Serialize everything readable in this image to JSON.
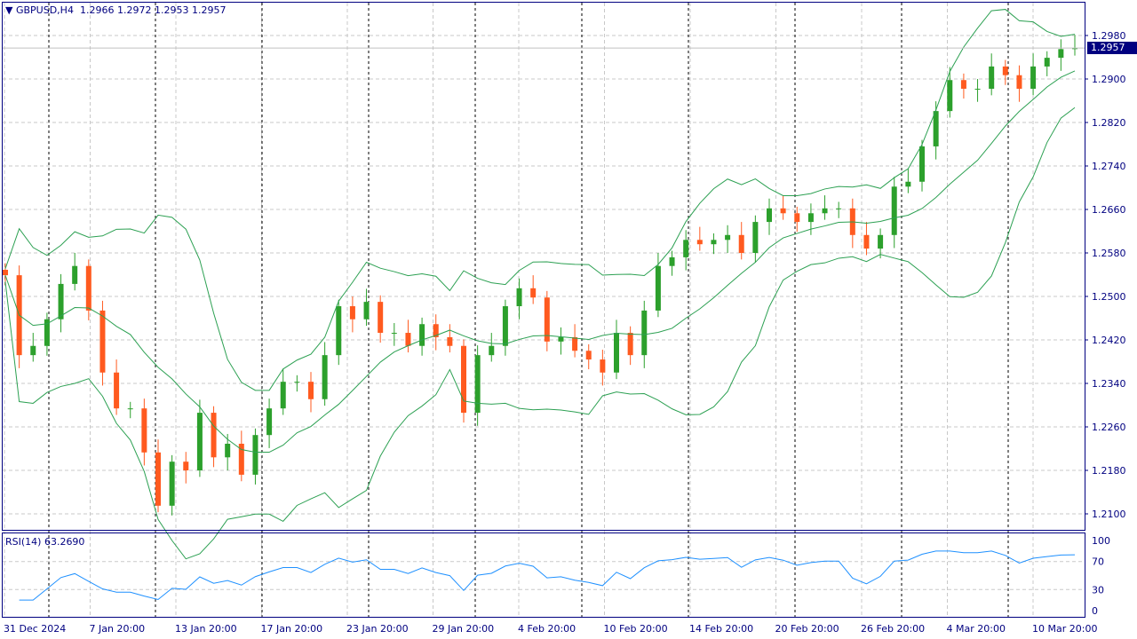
{
  "header": {
    "symbol": "GBPUSD,H4",
    "open": "1.2966",
    "high": "1.2972",
    "low": "1.2953",
    "close": "1.2957"
  },
  "current_price_label": "1.2957",
  "rsi_label": "RSI(14) 63.2690",
  "colors": {
    "frame": "#000080",
    "bull": "#2ca02c",
    "bear": "#ff5a1f",
    "bands": "#2ca052",
    "rsi": "#1e90ff",
    "grid": "#c8c8c8"
  },
  "chart_data": {
    "type": "candlestick",
    "title": "GBPUSD,H4",
    "ylim": [
      1.208,
      1.304
    ],
    "yticks": [
      "1.2980",
      "1.2900",
      "1.2820",
      "1.2740",
      "1.2660",
      "1.2580",
      "1.2500",
      "1.2420",
      "1.2340",
      "1.2260",
      "1.2180",
      "1.2100"
    ],
    "xticks": [
      "31 Dec 2024",
      "7 Jan 20:00",
      "13 Jan 20:00",
      "17 Jan 20:00",
      "23 Jan 20:00",
      "29 Jan 20:00",
      "4 Feb 20:00",
      "10 Feb 20:00",
      "14 Feb 20:00",
      "20 Feb 20:00",
      "26 Feb 20:00",
      "4 Mar 20:00",
      "10 Mar 20:00"
    ],
    "closes": [
      1.2539,
      1.2392,
      1.2409,
      1.2458,
      1.2523,
      1.2556,
      1.2474,
      1.236,
      1.2294,
      1.2294,
      1.2213,
      1.2115,
      1.2196,
      1.218,
      1.2286,
      1.2204,
      1.2229,
      1.2172,
      1.2245,
      1.2294,
      1.2343,
      1.2343,
      1.2311,
      1.2392,
      1.2482,
      1.2458,
      1.249,
      1.2433,
      1.2433,
      1.2409,
      1.2449,
      1.2425,
      1.2409,
      1.2286,
      1.2392,
      1.2409,
      1.2482,
      1.2515,
      1.2498,
      1.2417,
      1.2425,
      1.24,
      1.2384,
      1.236,
      1.2433,
      1.2392,
      1.2474,
      1.2556,
      1.2572,
      1.2604,
      1.2596,
      1.2604,
      1.2613,
      1.258,
      1.2637,
      1.2662,
      1.2653,
      1.2637,
      1.2653,
      1.2662,
      1.2662,
      1.2613,
      1.2588,
      1.2613,
      1.2702,
      1.2711,
      1.2776,
      1.2841,
      1.2898,
      1.2882,
      1.2882,
      1.2923,
      1.2907,
      1.2882,
      1.2923,
      1.2939,
      1.2955,
      1.2957
    ],
    "indicators": {
      "bollinger": {
        "period": 10,
        "deviations": 2
      },
      "rsi": {
        "period": 14,
        "levels": [
          70,
          30
        ],
        "ylim": [
          0,
          100
        ],
        "ticks": [
          "100",
          "70",
          "30",
          "0"
        ],
        "last": 63.269
      }
    }
  }
}
